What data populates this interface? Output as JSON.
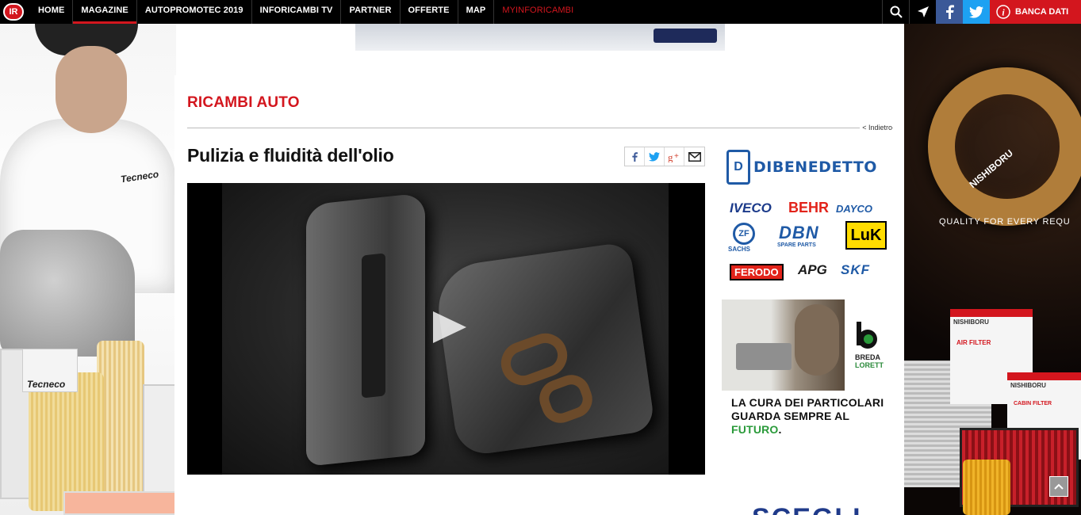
{
  "nav": {
    "logo": "IR",
    "items": [
      {
        "label": "HOME"
      },
      {
        "label": "MAGAZINE"
      },
      {
        "label": "AUTOPROMOTEC 2019"
      },
      {
        "label": "INFORICAMBI TV"
      },
      {
        "label": "PARTNER"
      },
      {
        "label": "OFFERTE"
      },
      {
        "label": "MAP"
      },
      {
        "label": "MYINFORICAMBI"
      }
    ],
    "active_item": "MAGAZINE",
    "banca_dati_label": "BANCA DATI",
    "icons": [
      "search-icon",
      "location-arrow-icon",
      "facebook-icon",
      "twitter-icon",
      "info-icon"
    ]
  },
  "colors": {
    "brand_red": "#d3161e",
    "facebook": "#3b5998",
    "twitter": "#1da1f2",
    "dibenedetto_blue": "#1f5aa6",
    "breda_green": "#2a9a3a"
  },
  "left_ad": {
    "coat_brand": "Tecneco",
    "box_brand": "Tecneco"
  },
  "right_ad": {
    "ring_brand": "NISHIBORU",
    "tagline": "QUALITY FOR EVERY REQU",
    "box1_brand": "NISHIBORU",
    "box1_label": "AIR FILTER",
    "box2_brand": "NISHIBORU",
    "box2_label": "CABIN FILTER"
  },
  "main": {
    "section_title": "RICAMBI AUTO",
    "back_link": "< Indietro",
    "article_title": "Pulizia e fluidità dell'olio",
    "share_icons": [
      "facebook-icon",
      "twitter-icon",
      "google-plus-icon",
      "mail-icon"
    ]
  },
  "sidebar": {
    "dibenedetto": {
      "name": "DIBENEDETTO",
      "brands": {
        "iveco": "IVECO",
        "behr": "BEHR",
        "dayco": "DAYCO",
        "zf": "ZF",
        "sachs": "SACHS",
        "dbn": "DBN",
        "spare_parts": "SPARE PARTS",
        "luk": "LuK",
        "ferodo": "FERODO",
        "apg": "APG",
        "skf": "SKF"
      }
    },
    "breda": {
      "logo_line1": "BREDA",
      "logo_line2": "LORETT",
      "claim_line1": "LA CURA DEI PARTICOLARI",
      "claim_line2": "GUARDA SEMPRE AL",
      "claim_green": "FUTURO",
      "claim_end": "."
    }
  },
  "bottom_teaser": "SCEGLI"
}
